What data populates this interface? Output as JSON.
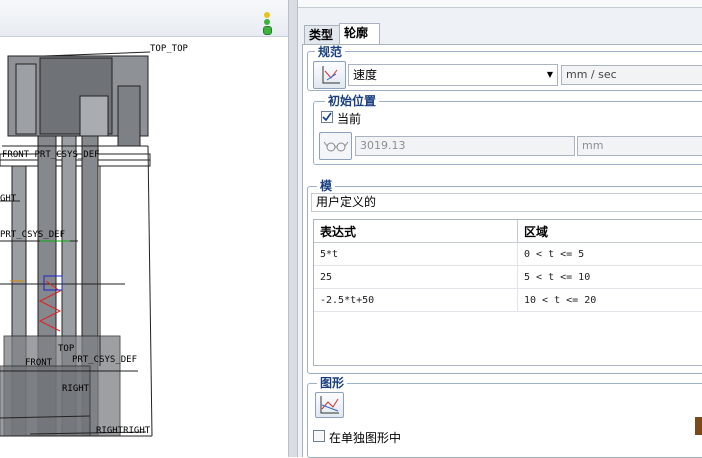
{
  "viewport": {
    "labels": {
      "top_top": "TOP_TOP",
      "front_prt_csys": "FRONT PRT_CSYS_DEF",
      "prt_csys_1": "PRT_CSYS_DEF",
      "prt_csys_2": "PRT_CSYS_DEF",
      "top": "TOP",
      "front": "FRONT",
      "right": "RIGHT",
      "rightright": "RIGHTRIGHT",
      "ght": "GHT"
    }
  },
  "panel": {
    "tabs": {
      "type": "类型",
      "profile": "轮廓"
    },
    "spec": {
      "title": "规范",
      "quantity_value": "速度",
      "unit_value": "mm / sec"
    },
    "initial_position": {
      "title": "初始位置",
      "current_label": "当前",
      "current_checked": true,
      "position_value": "3019.13",
      "position_unit": "mm"
    },
    "model": {
      "title": "模",
      "type_value": "用户定义的",
      "columns": {
        "expression": "表达式",
        "domain": "区域"
      },
      "rows": [
        {
          "expression": "5*t",
          "domain": "0 < t <= 5"
        },
        {
          "expression": "25",
          "domain": "5 < t <= 10"
        },
        {
          "expression": "-2.5*t+50",
          "domain": "10 < t <= 20"
        }
      ]
    },
    "graph": {
      "title": "图形",
      "separate_label": "在单独图形中",
      "separate_checked": false
    }
  },
  "colors": {
    "group_title": "#1a3f80",
    "traffic_green": "#3cb43c",
    "traffic_yellow": "#e6c419",
    "traffic_red": "#d8382f"
  },
  "icons": [
    "traffic-light-icon",
    "spec-graph-icon",
    "dropdown-arrow-icon",
    "glasses-icon",
    "graph-icon",
    "logo-fragment-icon"
  ]
}
